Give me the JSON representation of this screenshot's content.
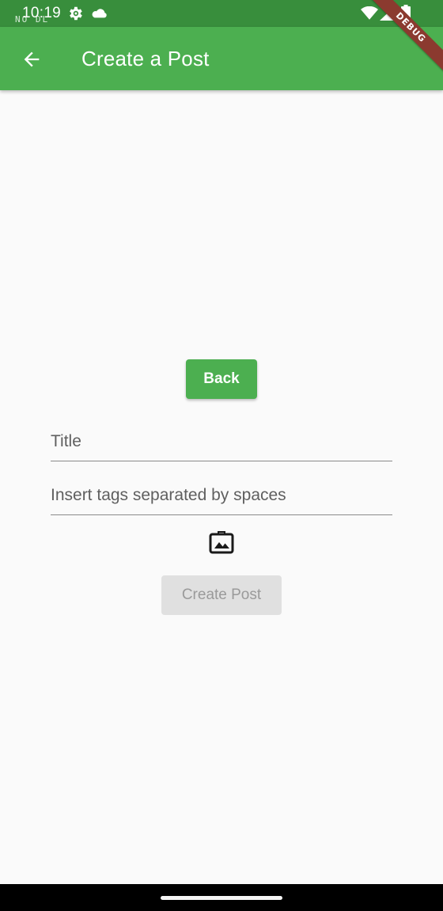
{
  "status_bar": {
    "time": "10:19",
    "indicator": "NO DL",
    "icons": [
      "settings-gear-icon",
      "cloud-icon",
      "wifi-icon",
      "cellular-signal-icon",
      "battery-icon"
    ]
  },
  "app_bar": {
    "title": "Create a Post",
    "back_icon": "arrow-back-icon"
  },
  "debug_banner": "DEBUG",
  "form": {
    "back_button_label": "Back",
    "title_placeholder": "Title",
    "tags_placeholder": "Insert tags separated by spaces",
    "image_picker_icon": "image-folder-icon",
    "create_button_label": "Create Post",
    "create_button_enabled": false
  },
  "colors": {
    "status_bar": "#388e3c",
    "app_bar": "#4caf50",
    "background": "#fafafa",
    "disabled_button": "#e0e0e0",
    "disabled_text": "#9a9a9a",
    "debug_banner": "#8b3a2f"
  }
}
